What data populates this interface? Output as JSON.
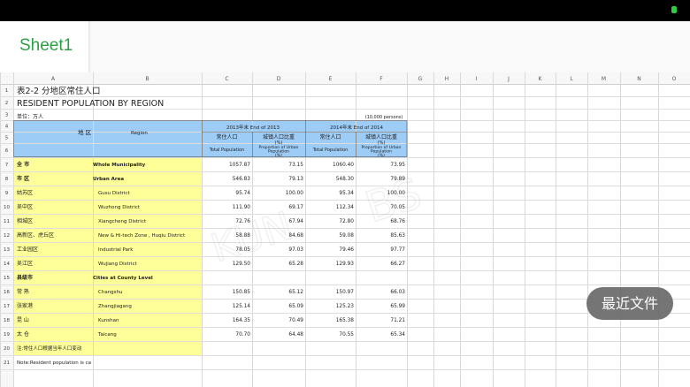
{
  "sheet_tab": {
    "label": "Sheet1"
  },
  "columns": [
    "A",
    "B",
    "C",
    "D",
    "E",
    "F",
    "G",
    "H",
    "I",
    "J",
    "K",
    "L",
    "M",
    "N",
    "O"
  ],
  "rows_numbers": [
    "1",
    "2",
    "3",
    "4",
    "5",
    "6",
    "7",
    "8",
    "9",
    "10",
    "11",
    "12",
    "13",
    "14",
    "15",
    "16",
    "17",
    "18",
    "19",
    "20",
    "21"
  ],
  "title_cn": "表2-2  分地区常住人口",
  "title_en": "RESIDENT POPULATION BY REGION",
  "unit": "单位：万人",
  "unit_en": "(10,000 persons)",
  "header": {
    "region_cn": "地  区",
    "region_en": "Region",
    "end2013": "2013年末   End of 2013",
    "end2014": "2014年末   End of 2014",
    "pop_cn": "常住人口",
    "urban_cn": "城镇人口比重",
    "urban_pct": "(%)",
    "total_pop": "Total Population",
    "urban_en": "Proportion of Urban Population",
    "pct": "(%)"
  },
  "data_rows": [
    {
      "cn": "全  市",
      "en": "Whole Municipality",
      "bold": true,
      "indent": false,
      "c": "1057.87",
      "d": "73.15",
      "e": "1060.40",
      "f": "73.95"
    },
    {
      "cn": "市  区",
      "en": "Urban Area",
      "bold": true,
      "indent": false,
      "c": "546.83",
      "d": "79.13",
      "e": "548.30",
      "f": "79.89"
    },
    {
      "cn": "姑苏区",
      "en": "Gusu District",
      "bold": false,
      "indent": true,
      "c": "95.74",
      "d": "100.00",
      "e": "95.34",
      "f": "100.00"
    },
    {
      "cn": "吴中区",
      "en": "Wuzhong District",
      "bold": false,
      "indent": true,
      "c": "111.90",
      "d": "69.17",
      "e": "112.34",
      "f": "70.05"
    },
    {
      "cn": "相城区",
      "en": "Xiangcheng District",
      "bold": false,
      "indent": true,
      "c": "72.76",
      "d": "67.94",
      "e": "72.80",
      "f": "68.76"
    },
    {
      "cn": "高新区、虎丘区",
      "en": "New & Hi-tech Zone , Huqiu District",
      "bold": false,
      "indent": true,
      "c": "58.88",
      "d": "84.68",
      "e": "59.08",
      "f": "85.63"
    },
    {
      "cn": "工业园区",
      "en": "Industrial Park",
      "bold": false,
      "indent": true,
      "c": "78.05",
      "d": "97.03",
      "e": "79.46",
      "f": "97.77"
    },
    {
      "cn": "吴江区",
      "en": "Wujiang District",
      "bold": false,
      "indent": true,
      "c": "129.50",
      "d": "65.28",
      "e": "129.93",
      "f": "66.27"
    },
    {
      "cn": "县级市",
      "en": "Cities at County Level",
      "bold": true,
      "indent": false,
      "c": "",
      "d": "",
      "e": "",
      "f": ""
    },
    {
      "cn": "常  熟",
      "en": "Changshu",
      "bold": false,
      "indent": true,
      "c": "150.85",
      "d": "65.12",
      "e": "150.97",
      "f": "66.03"
    },
    {
      "cn": "张家港",
      "en": "Zhangjiagang",
      "bold": false,
      "indent": true,
      "c": "125.14",
      "d": "65.09",
      "e": "125.23",
      "f": "65.99"
    },
    {
      "cn": "昆  山",
      "en": "Kunshan",
      "bold": false,
      "indent": true,
      "c": "164.35",
      "d": "70.49",
      "e": "165.38",
      "f": "71.21"
    },
    {
      "cn": "太  仓",
      "en": "Taicang",
      "bold": false,
      "indent": true,
      "c": "70.70",
      "d": "64.48",
      "e": "70.55",
      "f": "65.34"
    }
  ],
  "note_cn": "注:常住人口根据当年人口变动",
  "note_en": "Note:Resident population is ca",
  "recent_files": "最近文件",
  "colors": {
    "header_blue": "#9dccf7",
    "yellow": "#ffff99",
    "accent_green": "#2e9e45"
  }
}
